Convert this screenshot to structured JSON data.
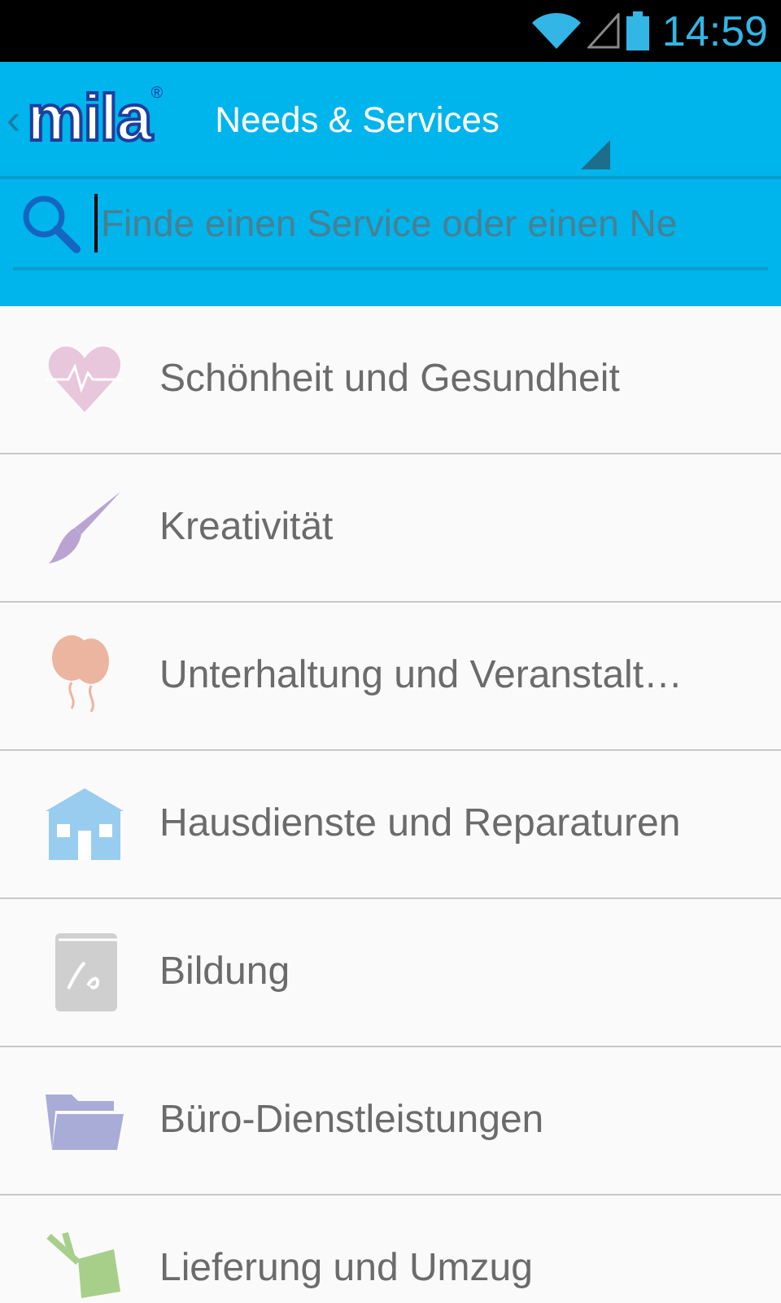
{
  "status_bar": {
    "time": "14:59"
  },
  "action_bar": {
    "back": "‹",
    "logo": "mila",
    "logo_mark": "®",
    "title": "Needs & Services"
  },
  "search": {
    "placeholder": "Finde einen Service oder einen Ne"
  },
  "categories": [
    {
      "label": "Schönheit und Gesundheit",
      "kind": "heart",
      "color": "#e8c6dc"
    },
    {
      "label": "Kreativität",
      "kind": "brush",
      "color": "#b9a3d3"
    },
    {
      "label": "Unterhaltung und Veranstalt…",
      "kind": "balloons",
      "color": "#ecb59f"
    },
    {
      "label": "Hausdienste und Reparaturen",
      "kind": "house",
      "color": "#98cdf0"
    },
    {
      "label": "Bildung",
      "kind": "book",
      "color": "#cfcfcf"
    },
    {
      "label": "Büro-Dienstleistungen",
      "kind": "folder",
      "color": "#a9acd6"
    },
    {
      "label": "Lieferung und Umzug",
      "kind": "plant",
      "color": "#a7cf8a"
    }
  ]
}
